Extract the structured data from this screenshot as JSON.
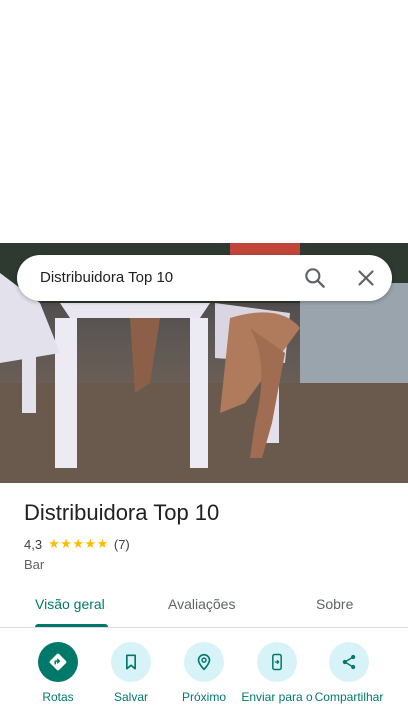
{
  "search": {
    "value": "Distribuidora Top 10",
    "search_icon": "search-icon",
    "close_icon": "close-icon"
  },
  "place": {
    "title": "Distribuidora Top 10",
    "rating": "4,3",
    "stars": "★★★★★",
    "reviews_count": "(7)",
    "category": "Bar"
  },
  "tabs": [
    {
      "label": "Visão geral"
    },
    {
      "label": "Avaliações"
    },
    {
      "label": "Sobre"
    }
  ],
  "actions": [
    {
      "label": "Rotas",
      "icon": "directions-icon"
    },
    {
      "label": "Salvar",
      "icon": "bookmark-icon"
    },
    {
      "label": "Próximo",
      "icon": "nearby-icon"
    },
    {
      "label": "Enviar para o",
      "icon": "send-to-phone-icon"
    },
    {
      "label": "Compartilhar",
      "icon": "share-icon"
    }
  ],
  "colors": {
    "accent": "#00796b",
    "action_bg": "#d7f3f8",
    "star": "#fbbc04"
  }
}
